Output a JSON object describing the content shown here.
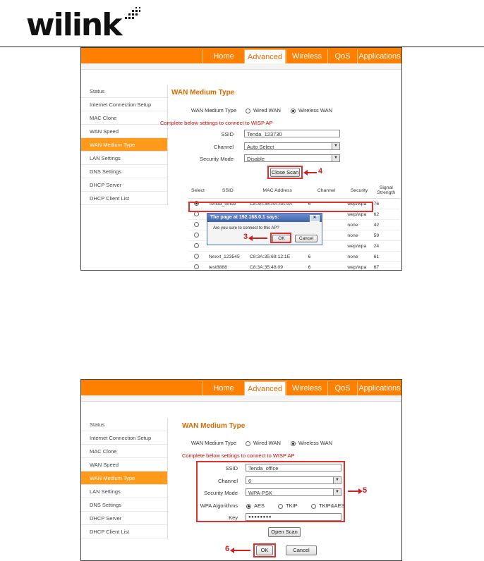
{
  "logo": {
    "text": "wilink"
  },
  "screenshot1": {
    "tabs": [
      "Home",
      "Advanced",
      "Wireless",
      "QoS",
      "Applications"
    ],
    "active_tab": "Advanced",
    "sidebar": [
      "Status",
      "Internet Connection Setup",
      "MAC Clone",
      "WAN Speed",
      "WAN Medium Type",
      "LAN Settings",
      "DNS Settings",
      "DHCP Server",
      "DHCP Client List"
    ],
    "active_sidebar": "WAN Medium Type",
    "page_title": "WAN Medium Type",
    "medium_label": "WAN Medium Type",
    "wired_label": "Wired WAN",
    "wireless_label": "Wireless WAN",
    "note": "Complete below settings to connect to WISP AP",
    "ssid_label": "SSID",
    "ssid_value": "Tenda_123730",
    "channel_label": "Channel",
    "channel_value": "Auto Select",
    "security_label": "Security Mode",
    "security_value": "Disable",
    "scan_button": "Close Scan",
    "callout_scan": "4",
    "table_headers": [
      "Select",
      "SSID",
      "MAC Address",
      "Channel",
      "Security",
      "Signal Strength"
    ],
    "table_rows": [
      [
        "Tenda_office",
        "C8:3A:35:AA:AA:9A",
        "6",
        "wep/wpa",
        "76"
      ],
      [
        "",
        "",
        "",
        "wep/wpa",
        "62"
      ],
      [
        "",
        "",
        "",
        "none",
        "42"
      ],
      [
        "",
        "",
        "",
        "none",
        "59"
      ],
      [
        "",
        "",
        "",
        "wep/wpa",
        "24"
      ],
      [
        "Nexxt_123545",
        "C8:3A:35:68:12:1E",
        "6",
        "none",
        "61"
      ],
      [
        "test8888",
        "C8:3A:35:48:09",
        "6",
        "wep/wpa",
        "67"
      ]
    ],
    "dialog": {
      "title": "The page at 192.168.0.1 says:",
      "message": "Are you sure to connect to this AP?",
      "ok": "OK",
      "cancel": "Cancel",
      "callout": "3"
    }
  },
  "screenshot2": {
    "tabs": [
      "Home",
      "Advanced",
      "Wireless",
      "QoS",
      "Applications"
    ],
    "active_tab": "Advanced",
    "sidebar": [
      "Status",
      "Internet Connection Setup",
      "MAC Clone",
      "WAN Speed",
      "WAN Medium Type",
      "LAN Settings",
      "DNS Settings",
      "DHCP Server",
      "DHCP Client List"
    ],
    "active_sidebar": "WAN Medium Type",
    "page_title": "WAN Medium Type",
    "medium_label": "WAN Medium Type",
    "wired_label": "Wired WAN",
    "wireless_label": "Wireless WAN",
    "note": "Complete below settings to connect to WISP AP",
    "ssid_label": "SSID",
    "ssid_value": "Tenda_office",
    "channel_label": "Channel",
    "channel_value": "6",
    "security_label": "Security Mode",
    "security_value": "WPA-PSK",
    "wpa_label": "WPA Algorithms",
    "wpa_options": [
      "AES",
      "TKIP",
      "TKIP&AES"
    ],
    "key_label": "Key",
    "key_value": "●●●●●●●●",
    "scan_button": "Open Scan",
    "ok_button": "OK",
    "cancel_button": "Cancel",
    "callout_settings": "5",
    "callout_ok": "6"
  }
}
